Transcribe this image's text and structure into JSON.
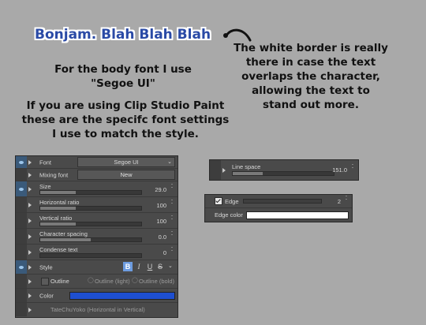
{
  "title": "Bonjam. Blah Blah Blah",
  "notes": {
    "right": "The white border is really there in case the text overlaps the character, allowing the text to stand out more.",
    "body_font": "For the body font I use \"Segoe UI\"",
    "csp": "If you are using Clip Studio Paint these are the specifc font settings I use to match the style."
  },
  "panel_main": {
    "font_label": "Font",
    "font_value": "Segoe UI",
    "mixing_font_label": "Mixing font",
    "mixing_font_button": "New",
    "size_label": "Size",
    "size_value": "29.0",
    "size_fraction": 0.35,
    "horizontal_ratio_label": "Horizontal ratio",
    "horizontal_ratio_value": "100",
    "horizontal_ratio_fraction": 0.35,
    "vertical_ratio_label": "Vertical ratio",
    "vertical_ratio_value": "100",
    "vertical_ratio_fraction": 0.35,
    "character_spacing_label": "Character spacing",
    "character_spacing_value": "0.0",
    "character_spacing_fraction": 0.5,
    "condense_text_label": "Condense text",
    "condense_text_value": "0",
    "condense_text_fraction": 0.0,
    "style_label": "Style",
    "style_bold": "B",
    "style_italic": "I",
    "style_underline": "U",
    "style_strike": "S",
    "outline_label": "Outline",
    "outline_light_label": "Outline (light)",
    "outline_bold_label": "Outline (bold)",
    "color_label": "Color",
    "color_swatch": "#1e4fd0",
    "tatechuyoko_label": "TateChuYoko (Horizontal in Vertical)"
  },
  "panel_line": {
    "line_space_label": "Line space",
    "line_space_value": "151.0",
    "line_space_fraction": 0.3
  },
  "panel_edge": {
    "edge_label": "Edge",
    "edge_value": "2",
    "edge_color_label": "Edge color",
    "edge_color_swatch": "#ffffff"
  },
  "icons": {
    "spin": "up-down-spinner-icon",
    "dropdown": "chevron-down-icon",
    "visibility": "eye-icon",
    "expand": "triangle-right-icon"
  }
}
